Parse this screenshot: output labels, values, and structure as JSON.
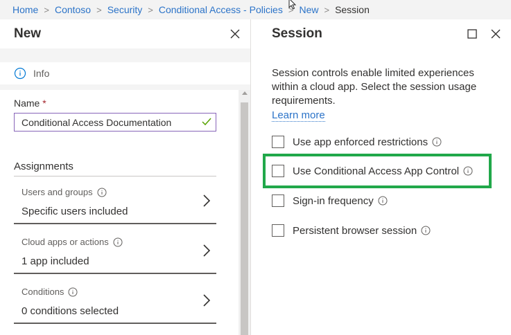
{
  "breadcrumb": {
    "items": [
      "Home",
      "Contoso",
      "Security",
      "Conditional Access - Policies",
      "New",
      "Session"
    ],
    "separator": ">"
  },
  "left_blade": {
    "title": "New",
    "info_label": "Info",
    "name_label": "Name",
    "required_mark": "*",
    "name_value": "Conditional Access Documentation",
    "assignments_heading": "Assignments",
    "assignments": [
      {
        "label": "Users and groups",
        "value": "Specific users included"
      },
      {
        "label": "Cloud apps or actions",
        "value": "1 app included"
      },
      {
        "label": "Conditions",
        "value": "0 conditions selected"
      }
    ]
  },
  "right_blade": {
    "title": "Session",
    "description": "Session controls enable limited experiences within a cloud app. Select the session usage requirements.",
    "learn_more": "Learn more",
    "options": [
      {
        "label": "Use app enforced restrictions",
        "checked": false
      },
      {
        "label": "Use Conditional Access App Control",
        "checked": false,
        "highlighted": true
      },
      {
        "label": "Sign-in frequency",
        "checked": false
      },
      {
        "label": "Persistent browser session",
        "checked": false
      }
    ]
  },
  "colors": {
    "link": "#2b73c8",
    "highlight_box": "#21a84a",
    "input_focus_border": "#8764b8",
    "required": "#a4262c"
  }
}
